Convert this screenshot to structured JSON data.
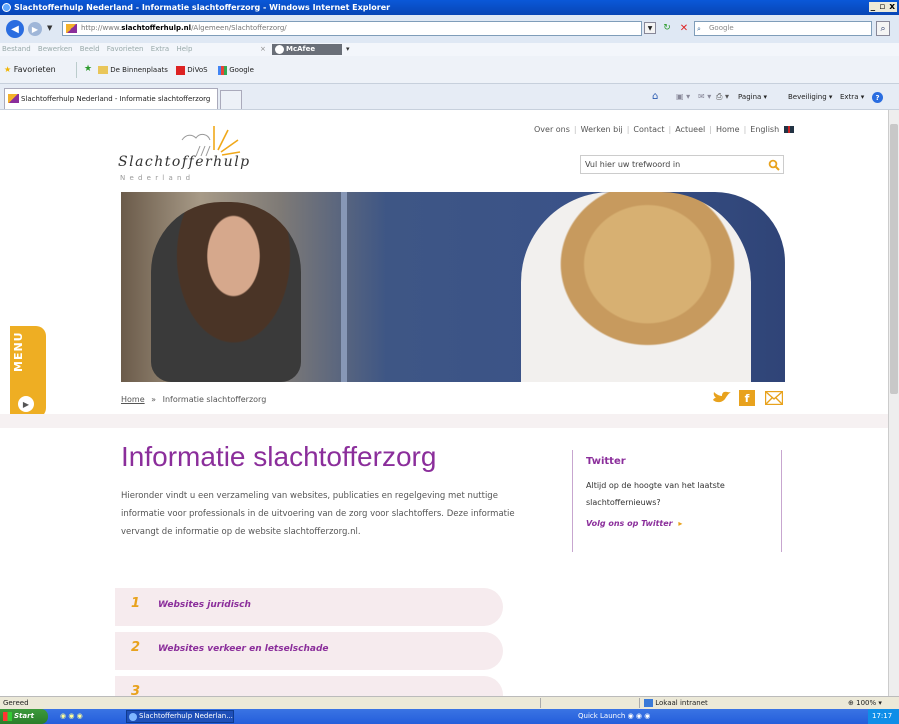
{
  "browser": {
    "window_title": "Slachtofferhulp Nederland - Informatie slachtofferzorg - Windows Internet Explorer",
    "url_prefix": "http://www.",
    "url_domain": "slachtofferhulp.nl",
    "url_path": "/Algemeen/Slachtofferzorg/",
    "search_placeholder": "Google",
    "menu": [
      "Bestand",
      "Bewerken",
      "Beeld",
      "Favorieten",
      "Extra",
      "Help"
    ],
    "mcafee_label": "McAfee",
    "favorites_label": "Favorieten",
    "favorite_links": [
      "De Binnenplaats",
      "DiVoS",
      "Google"
    ],
    "tab_title": "Slachtofferhulp Nederland - Informatie slachtofferzorg",
    "toolbar_right": [
      "Pagina",
      "Beveiliging",
      "Extra"
    ]
  },
  "site": {
    "logo_name": "Slachtofferhulp",
    "logo_sub": "N e d e r l a n d",
    "top_nav": [
      "Over ons",
      "Werken bij",
      "Contact",
      "Actueel",
      "Home",
      "English"
    ],
    "search_placeholder": "Vul hier uw trefwoord in",
    "menu_tab": "MENU",
    "breadcrumb": {
      "home": "Home",
      "separator": "»",
      "current": "Informatie slachtofferzorg"
    },
    "page_title": "Informatie slachtofferzorg",
    "intro": "Hieronder vindt u een verzameling van websites, publicaties en regelgeving met nuttige informatie voor professionals in de uitvoering van de zorg voor slachtoffers. Deze informatie vervangt de informatie op de website slachtofferzorg.nl.",
    "twitter": {
      "title": "Twitter",
      "text": "Altijd op de hoogte van het laatste slachtoffernieuws?",
      "link": "Volg ons op Twitter"
    },
    "list": [
      {
        "num": "1",
        "label": "Websites juridisch"
      },
      {
        "num": "2",
        "label": "Websites verkeer en letselschade"
      },
      {
        "num": "3",
        "label": ""
      }
    ],
    "colors": {
      "purple": "#8b2e9b",
      "orange": "#e8a21d"
    }
  },
  "status": {
    "text": "Gereed",
    "zone": "Lokaal intranet",
    "zoom": "100%"
  },
  "taskbar": {
    "start": "Start",
    "window": "Slachtofferhulp Nederlan...",
    "quick_launch": "Quick Launch",
    "clock": "17:17"
  }
}
